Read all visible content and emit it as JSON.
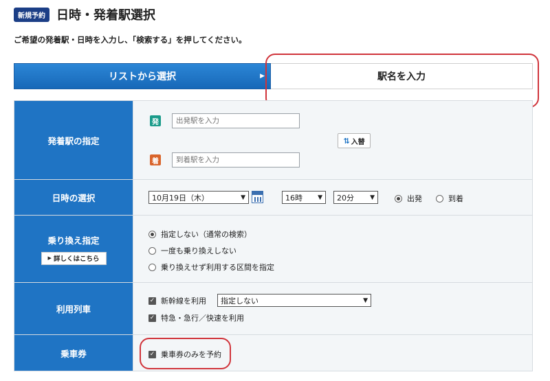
{
  "header": {
    "badge": "新規予約",
    "title": "日時・発着駅選択",
    "instruction": "ご希望の発着駅・日時を入力し、「検索する」を押してください。"
  },
  "tabs": {
    "list_label": "リストから選択",
    "station_label": "駅名を入力"
  },
  "stations": {
    "label": "発着駅の指定",
    "departure_icon": "発",
    "departure_placeholder": "出発駅を入力",
    "arrival_icon": "着",
    "arrival_placeholder": "到着駅を入力",
    "swap_label": "入替"
  },
  "datetime": {
    "label": "日時の選択",
    "date": "10月19日（木）",
    "hour": "16時",
    "minute": "20分",
    "departure": "出発",
    "arrival": "到着",
    "selected": "departure"
  },
  "transfer": {
    "label": "乗り換え指定",
    "details_button": "詳しくはこちら",
    "options": [
      "指定しない（通常の検索）",
      "一度も乗り換えしない",
      "乗り換えせず利用する区間を指定"
    ],
    "selected_index": 0
  },
  "trains": {
    "label": "利用列車",
    "shinkansen_label": "新幹線を利用",
    "shinkansen_checked": true,
    "shinkansen_select": "指定しない",
    "express_label": "特急・急行／快速を利用",
    "express_checked": true
  },
  "ticket": {
    "label": "乗車券",
    "only_ticket_label": "乗車券のみを予約",
    "checked": true
  },
  "colors": {
    "brand_blue": "#1f74c4",
    "badge_navy": "#1b3e86",
    "departure_green": "#1a9b8a",
    "arrival_orange": "#d9642b",
    "highlight_red": "#d0333a"
  }
}
